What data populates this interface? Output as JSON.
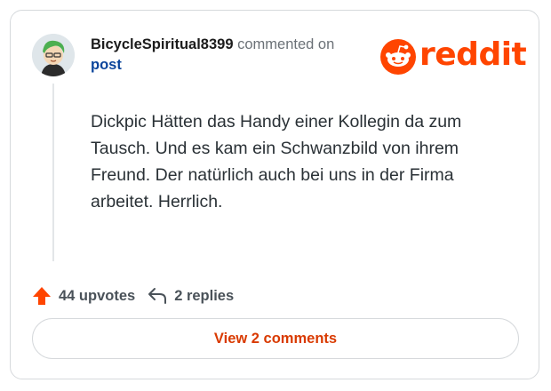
{
  "comment": {
    "username": "BicycleSpiritual8399",
    "action_text": "commented on",
    "post_link": "post",
    "body": "Dickpic Hätten das Handy einer Kollegin da zum Tausch. Und es kam ein Schwanzbild von ihrem Freund. Der natürlich auch bei uns in der Firma arbeitet. Herrlich."
  },
  "brand": {
    "logo_text": "reddit",
    "color": "#ff4500"
  },
  "footer": {
    "upvotes_label": "44 upvotes",
    "replies_label": "2 replies",
    "view_comments_label": "View 2 comments",
    "upvote_icon": "upvote-arrow-icon",
    "reply_icon": "reply-arrow-icon"
  },
  "colors": {
    "accent": "#ff4500",
    "link": "#0a449b",
    "button_text": "#d93a00"
  }
}
